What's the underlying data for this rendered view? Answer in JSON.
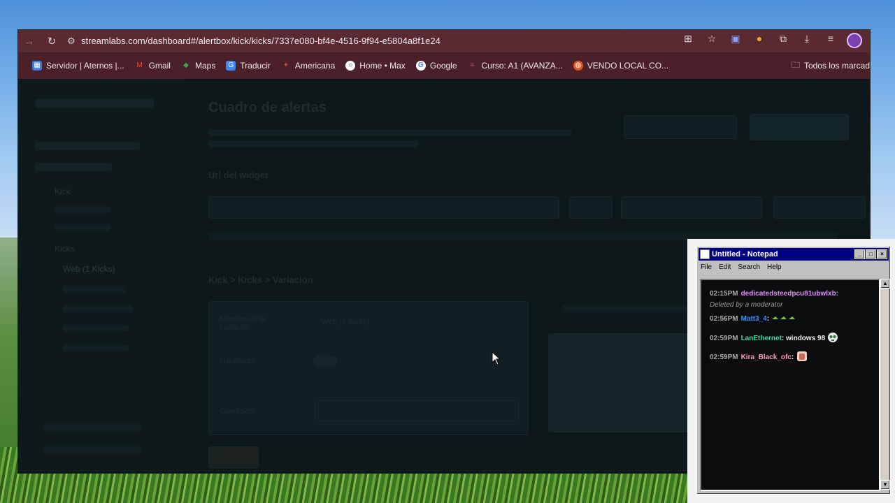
{
  "browser": {
    "url": "streamlabs.com/dashboard#/alertbox/kick/kicks/7337e080-bf4e-4516-9f94-e5804a8f1e24",
    "bookmarks": [
      {
        "label": "Servidor | Aternos |...",
        "icon": "aternos-icon",
        "color": "#3f7bd6"
      },
      {
        "label": "Gmail",
        "icon": "gmail-icon",
        "color": "#d93025"
      },
      {
        "label": "Maps",
        "icon": "maps-icon",
        "color": "#34a853"
      },
      {
        "label": "Traducir",
        "icon": "translate-icon",
        "color": "#4285f4"
      },
      {
        "label": "Americana",
        "icon": "americana-icon",
        "color": "#c0392b"
      },
      {
        "label": "Home • Max",
        "icon": "max-icon",
        "color": "#111111"
      },
      {
        "label": "Google",
        "icon": "google-icon",
        "color": "#ffffff"
      },
      {
        "label": "Curso: A1 (AVANZA...",
        "icon": "curso-icon",
        "color": "#b01030"
      },
      {
        "label": "VENDO LOCAL CO...",
        "icon": "vendo-icon",
        "color": "#e0561f"
      }
    ],
    "all_bookmarks_label": "Todos los marcad"
  },
  "page": {
    "title": "Cuadro de alertas",
    "url_widget_label": "Url del widget",
    "section_title": "Kick > Kicks > Variación",
    "sidebar_items": [
      "Kick",
      "Kicks",
      "Web (1 Kicks)"
    ],
    "variation_name_label": "Nombre de la variación",
    "variation_value": "Web (1 Kicks)",
    "enabled_label": "Habilitado",
    "condition_label": "Condición"
  },
  "notepad": {
    "title": "Untitled - Notepad",
    "menu": [
      "File",
      "Edit",
      "Search",
      "Help"
    ],
    "chat": [
      {
        "time": "02:15PM",
        "user": "dedicatedsteedpcu81ubwlxb:",
        "user_color": "#d98cf0",
        "text": "",
        "note": "Deleted by a moderator"
      },
      {
        "time": "02:56PM",
        "user": "Matt3_4",
        "user_color": "#3a8fff",
        "text": ":",
        "emotes": 3
      },
      {
        "time": "02:59PM",
        "user": "LanEthernet",
        "user_color": "#3fd9a0",
        "text": ": windows 98"
      },
      {
        "time": "02:59PM",
        "user": "Kira_Black_ofc",
        "user_color": "#ff9ab8",
        "text": ":"
      }
    ]
  }
}
